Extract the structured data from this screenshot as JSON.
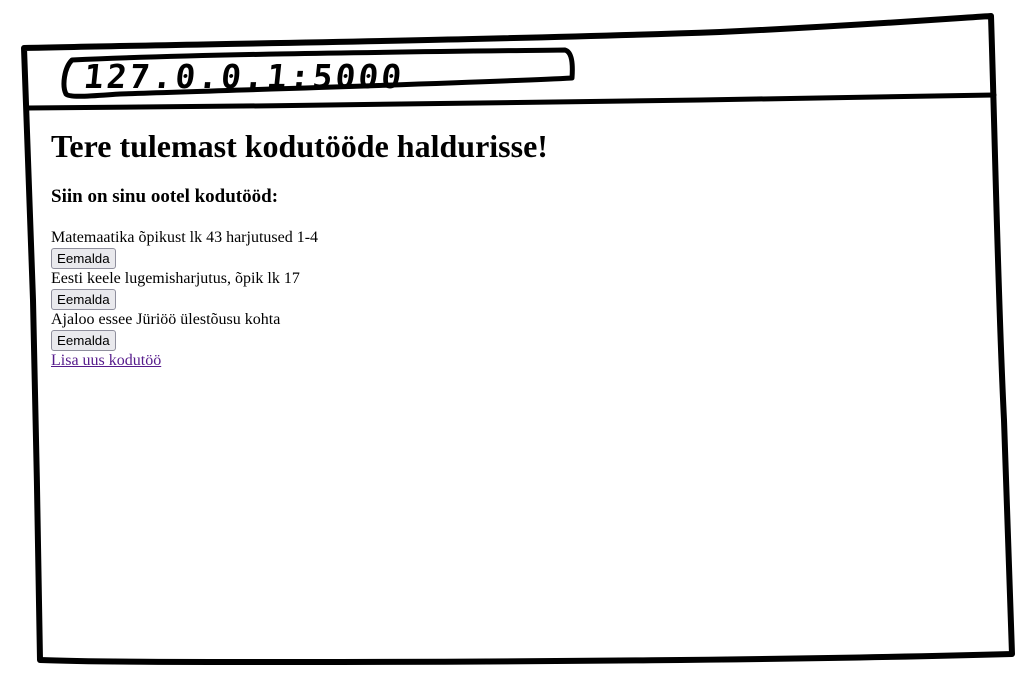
{
  "browser": {
    "url": "127.0.0.1:5000"
  },
  "page": {
    "title": "Tere tulemast kodutööde haldurisse!",
    "subtitle": "Siin on sinu ootel kodutööd:",
    "tasks": [
      {
        "text": "Matemaatika õpikust lk 43 harjutused 1-4",
        "button_label": "Eemalda"
      },
      {
        "text": "Eesti keele lugemisharjutus, õpik lk 17",
        "button_label": "Eemalda"
      },
      {
        "text": "Ajaloo essee Jüriöö ülestõusu kohta",
        "button_label": "Eemalda"
      }
    ],
    "add_link_label": "Lisa uus kodutöö"
  },
  "colors": {
    "visited_link": "#551a8b",
    "button_bg": "#e9e9ed",
    "sketch_stroke": "#000000"
  }
}
